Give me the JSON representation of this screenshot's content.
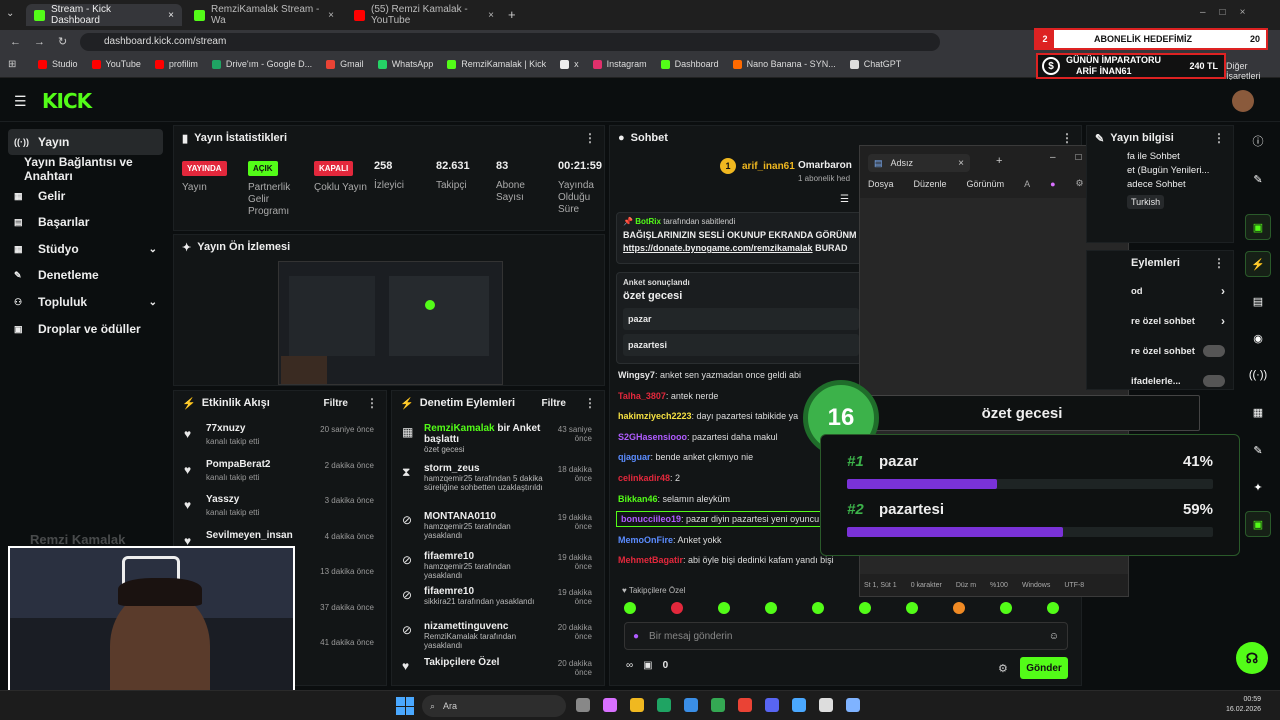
{
  "browser": {
    "tabs": [
      {
        "title": "Stream - Kick Dashboard",
        "active": true
      },
      {
        "title": "RemziKamalak Stream - Wa",
        "active": false
      },
      {
        "title": "(55) Remzi Kamalak - YouTube",
        "active": false
      }
    ],
    "address": "dashboard.kick.com/stream",
    "bookmarks": [
      "Studio",
      "YouTube",
      "profilim",
      "Drive'ım - Google D...",
      "Gmail",
      "WhatsApp",
      "RemziKamalak | Kick",
      "x",
      "Instagram",
      "Dashboard",
      "Nano Banana - SYN...",
      "ChatGPT"
    ],
    "other_bookmarks": "Diğer İşaretleri"
  },
  "overlay": {
    "sub_goal": {
      "count": "2",
      "label": "ABONELİK HEDEFİMİZ",
      "target": "20"
    },
    "emperor": {
      "title": "GÜNÜN İMPARATORU",
      "name": "ARİF İNAN61",
      "amount": "240 TL"
    },
    "poll": {
      "count": "16",
      "title": "özet gecesi",
      "options": [
        {
          "rank": "#1",
          "name": "pazar",
          "pct": "41%",
          "value": 41
        },
        {
          "rank": "#2",
          "name": "pazartesi",
          "pct": "59%",
          "value": 59
        }
      ]
    }
  },
  "sidebar": {
    "items": [
      {
        "label": "Yayın",
        "icon": "broadcast-icon"
      },
      {
        "label": "Yayın Bağlantısı ve Anahtarı",
        "icon": ""
      },
      {
        "label": "Gelir",
        "icon": "revenue-icon"
      },
      {
        "label": "Başarılar",
        "icon": "badge-icon"
      },
      {
        "label": "Stüdyo",
        "icon": "studio-icon"
      },
      {
        "label": "Denetleme",
        "icon": "wrench-icon"
      },
      {
        "label": "Topluluk",
        "icon": "community-icon"
      },
      {
        "label": "Droplar ve ödüller",
        "icon": "gift-icon"
      }
    ]
  },
  "stats": {
    "title": "Yayın İstatistikleri",
    "items": [
      {
        "tag": "YAYINDA",
        "tag_color": "#e3283c",
        "label": "Yayın"
      },
      {
        "tag": "AÇIK",
        "tag_color": "#53fc18",
        "label": "Partnerlik Gelir Programı"
      },
      {
        "tag": "KAPALI",
        "tag_color": "#e3283c",
        "label": "Çoklu Yayın"
      },
      {
        "value": "258",
        "label": "İzleyici"
      },
      {
        "value": "82.631",
        "label": "Takipçi"
      },
      {
        "value": "83",
        "label": "Abone Sayısı"
      },
      {
        "value": "00:21:59",
        "label": "Yayında Olduğu Süre"
      }
    ]
  },
  "preview": {
    "title": "Yayın Ön İzlemesi"
  },
  "activity": {
    "title": "Etkinlik Akışı",
    "filter": "Filtre",
    "items": [
      {
        "name": "77xnuzy",
        "sub": "kanalı takip etti",
        "time": "20 saniye önce"
      },
      {
        "name": "PompaBerat2",
        "sub": "kanalı takip etti",
        "time": "2 dakika önce"
      },
      {
        "name": "Yasszy",
        "sub": "kanalı takip etti",
        "time": "3 dakika önce"
      },
      {
        "name": "Sevilmeyen_insan",
        "sub": "",
        "time": "4 dakika önce"
      },
      {
        "name": "",
        "sub": "",
        "time": "13 dakika önce"
      },
      {
        "name": "",
        "sub": "",
        "time": "37 dakika önce"
      },
      {
        "name": "",
        "sub": "",
        "time": "41 dakika önce"
      }
    ]
  },
  "moderation": {
    "title": "Denetim Eylemleri",
    "filter": "Filtre",
    "items": [
      {
        "name": "RemziKamalak",
        "rest": " bir Anket başlattı",
        "sub": "özet gecesi",
        "time": "43 saniye önce"
      },
      {
        "name": "storm_zeus",
        "rest": "",
        "sub": "hamzqemir25 tarafından 5 dakika süreliğine sohbetten uzaklaştırıldı",
        "time": "18 dakika önce"
      },
      {
        "name": "MONTANA0110",
        "rest": "",
        "sub": "hamzqemir25 tarafından yasaklandı",
        "time": "19 dakika önce"
      },
      {
        "name": "fifaemre10",
        "rest": "",
        "sub": "hamzqemir25 tarafından yasaklandı",
        "time": "19 dakika önce"
      },
      {
        "name": "fifaemre10",
        "rest": "",
        "sub": "sikkira21 tarafından yasaklandı",
        "time": "19 dakika önce"
      },
      {
        "name": "nizamettinguvenc",
        "rest": "",
        "sub": "RemziKamalak tarafından yasaklandı",
        "time": "20 dakika önce"
      },
      {
        "name": "Takipçilere Özel",
        "rest": "",
        "sub": "",
        "time": "20 dakika önce"
      }
    ]
  },
  "chat": {
    "title": "Sohbet",
    "top_user": "arif_inan61",
    "top_user2": "Omarbaron",
    "top_count": "1",
    "sub_note": "1 abonelik hed",
    "pinned": {
      "by": "BotRix",
      "by_rest": " tarafından sabitlendi",
      "text": "BAĞIŞLARINIZIN SESLİ OKUNUP EKRANDA GÖRÜNM",
      "link": "https://donate.bynogame.com/remzikamalak",
      "link_rest": " BURAD"
    },
    "poll": {
      "label": "Anket sonuçlandı",
      "title": "özet gecesi",
      "options": [
        "pazar",
        "pazartesi"
      ]
    },
    "messages": [
      {
        "user": "Wingsy7",
        "color": "#e8e8e8",
        "text": ": anket sen yazmadan once geldi abi"
      },
      {
        "user": "Talha_3807",
        "color": "#e3283c",
        "text": ": antek nerde"
      },
      {
        "user": "hakimziyech2223",
        "color": "#f5e042",
        "text": ": dayı pazartesi tabikide ya"
      },
      {
        "user": "S2GHasensiooo",
        "color": "#b05cff",
        "text": ": pazartesi daha makul"
      },
      {
        "user": "qjaguar",
        "color": "#5b8cff",
        "text": ": bende anket çıkmıyo nie"
      },
      {
        "user": "celinkadir48",
        "color": "#e3283c",
        "text": ": 2"
      },
      {
        "user": "Bikkan46",
        "color": "#53fc18",
        "text": ": selamın aleyküm"
      },
      {
        "user": "bonucciileo19",
        "color": "#b05cff",
        "text": ": pazar diyin pazartesi yeni oyuncu"
      },
      {
        "user": "MemoOnFire",
        "color": "#5b8cff",
        "text": ": Anket yokk"
      },
      {
        "user": "MehmetBagatir",
        "color": "#e3283c",
        "text": ": abi öyle bişi dedinki kafam yandı bişi"
      }
    ],
    "followers_only": "Takipçilere Özel",
    "input_placeholder": "Bir mesaj gönderin",
    "points": "0",
    "send": "Gönder"
  },
  "info": {
    "title": "Yayın bilgisi",
    "lines": [
      "fa ile Sohbet",
      "et (Bugün Yenileri...",
      "adece Sohbet"
    ],
    "tag": "Turkish"
  },
  "actions": {
    "title": "Eylemleri",
    "items": [
      "od",
      "re özel sohbet",
      "re özel sohbet",
      "ifadelerle..."
    ]
  },
  "notepad": {
    "title": "Adsız",
    "menu": [
      "Dosya",
      "Düzenle",
      "Görünüm"
    ],
    "status": [
      "St 1, Süt 1",
      "0 karakter",
      "Düz m",
      "%100",
      "Windows",
      "UTF-8"
    ]
  },
  "webcam_name": "Remzi Kamalak",
  "taskbar": {
    "search": "Ara",
    "time": "00:59",
    "date": "16.02.2026"
  }
}
